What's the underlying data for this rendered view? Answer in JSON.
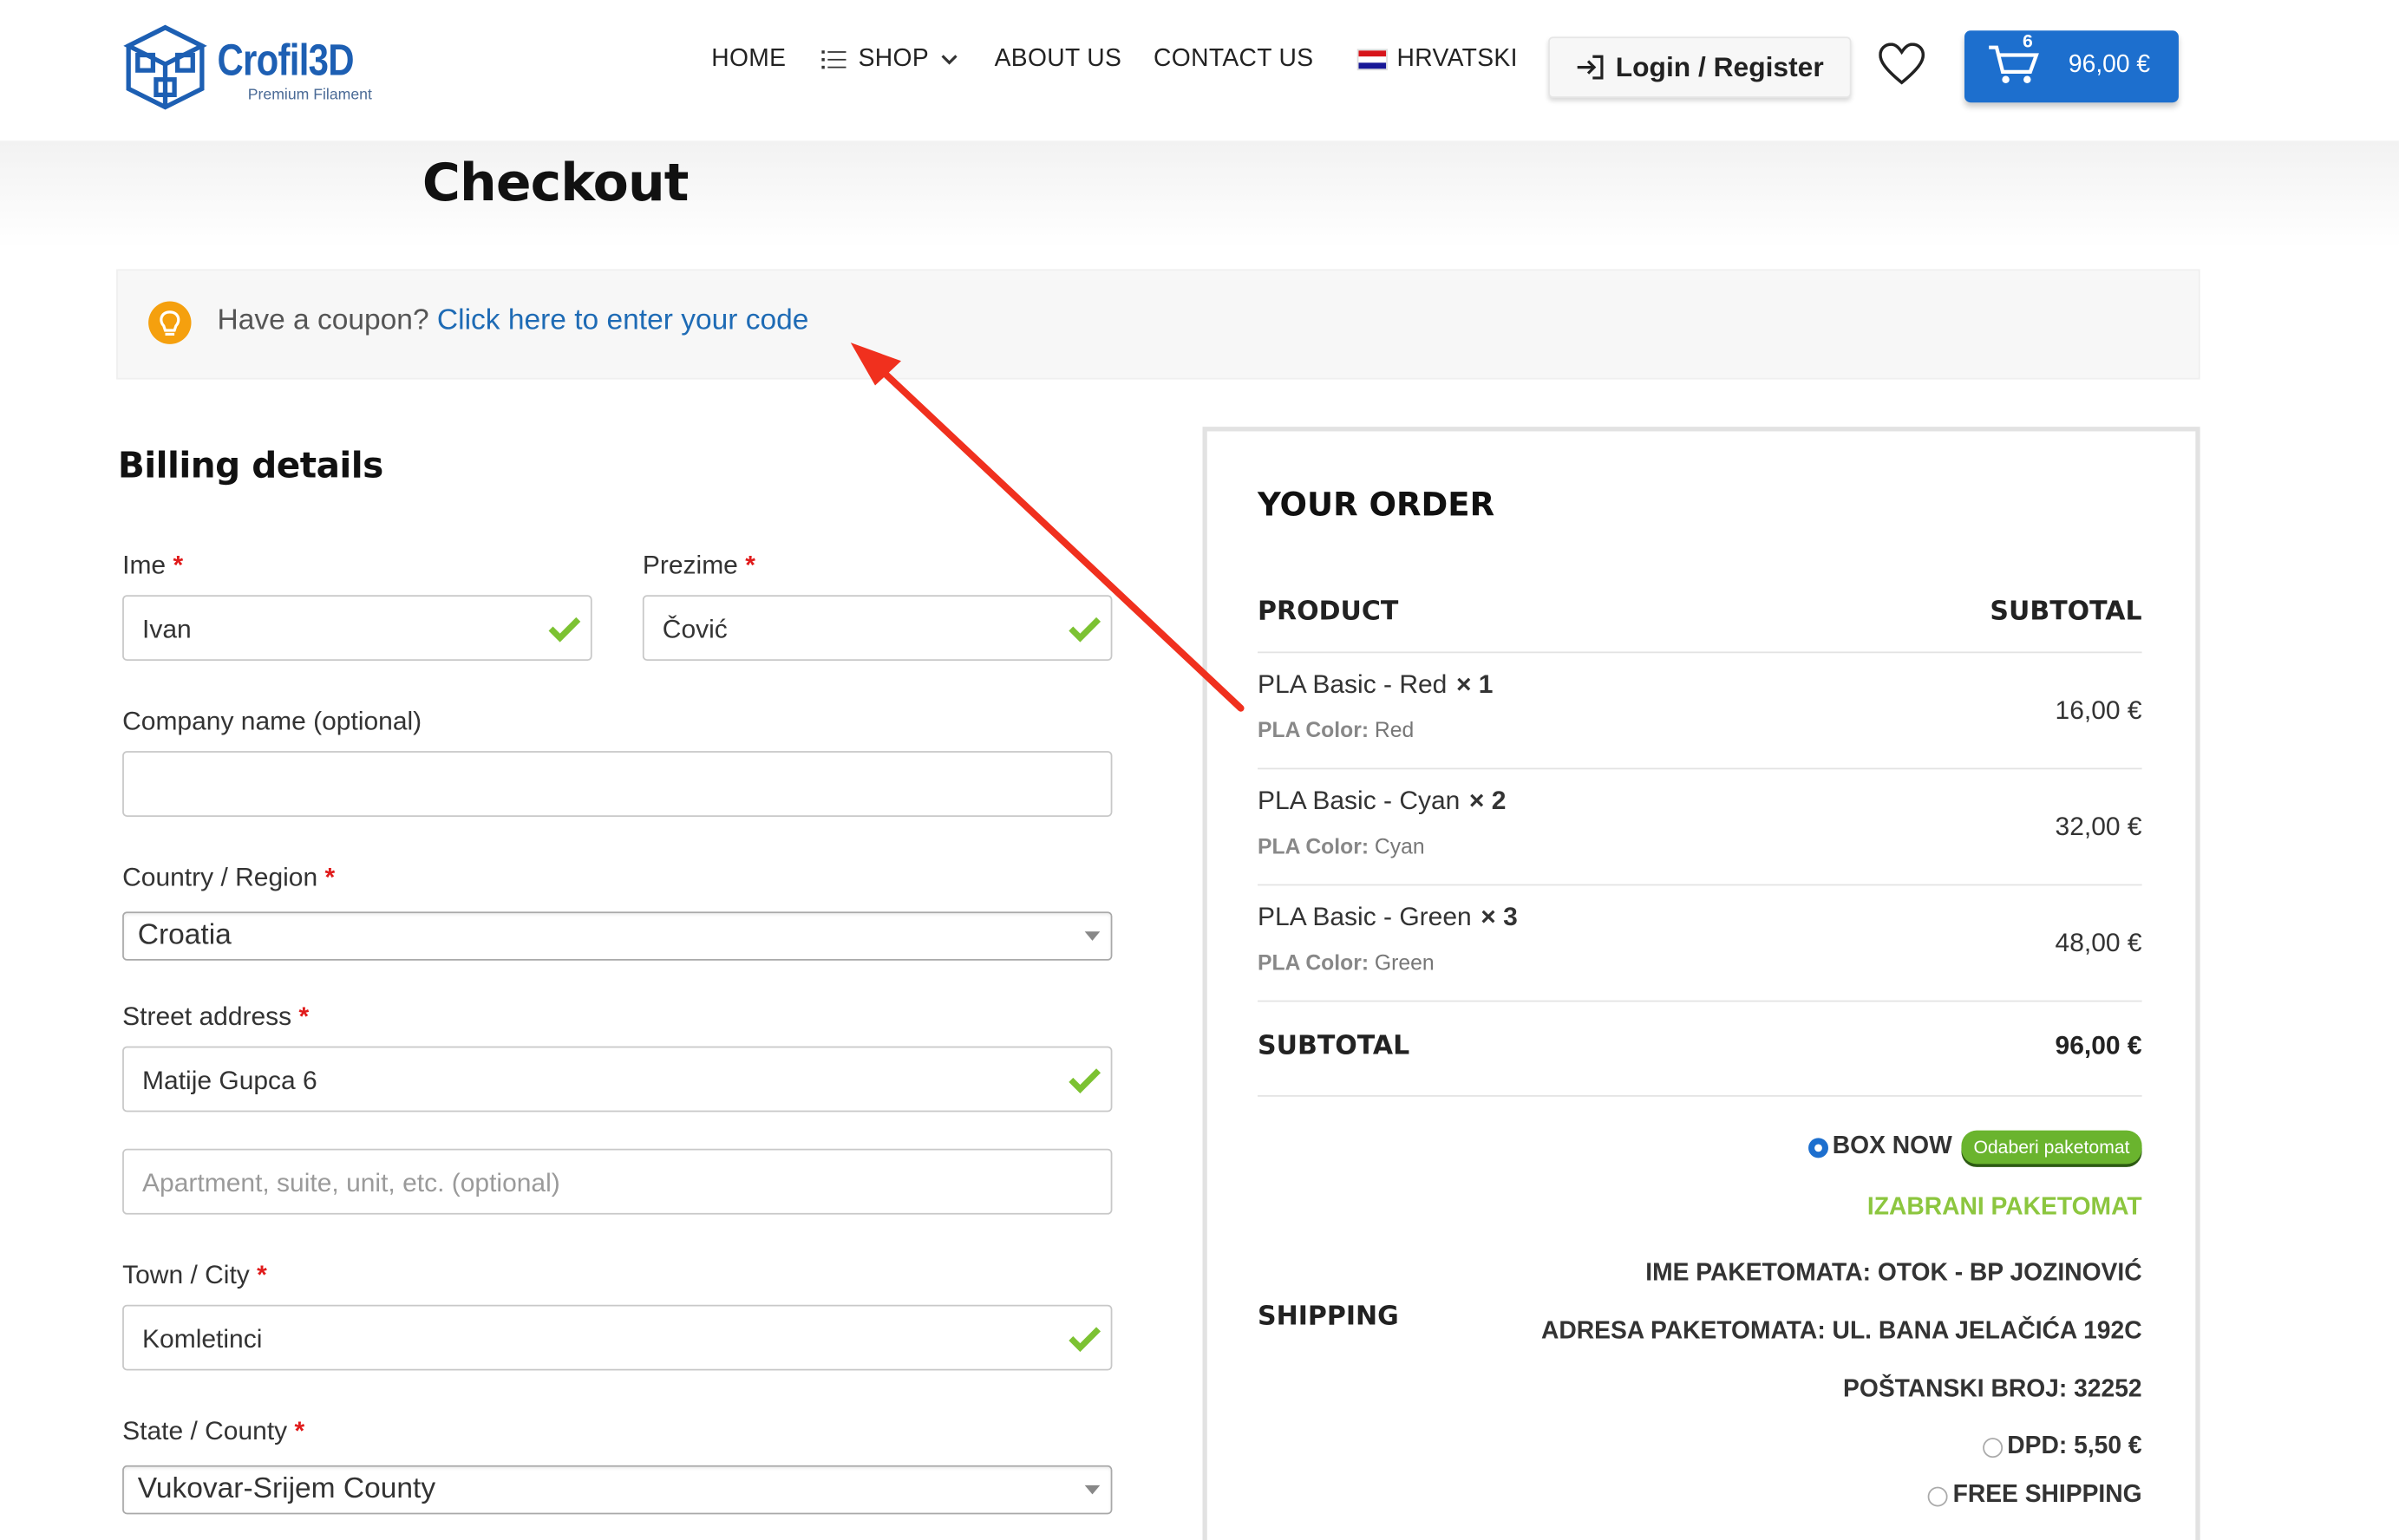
{
  "header": {
    "logo_name": "Crofil3D",
    "logo_tagline": "Premium Filament",
    "nav": {
      "home": "HOME",
      "shop": "SHOP",
      "about": "ABOUT US",
      "contact": "CONTACT US",
      "language": "HRVATSKI"
    },
    "login_label": "Login / Register",
    "cart_count": "6",
    "cart_total": "96,00 €"
  },
  "page": {
    "title": "Checkout"
  },
  "coupon": {
    "text": "Have a coupon?",
    "link": "Click here to enter your code"
  },
  "billing": {
    "title": "Billing details",
    "first_name": {
      "label": "Ime",
      "value": "Ivan"
    },
    "last_name": {
      "label": "Prezime",
      "value": "Čović"
    },
    "company": {
      "label": "Company name (optional)",
      "value": ""
    },
    "country": {
      "label": "Country / Region",
      "value": "Croatia"
    },
    "street": {
      "label": "Street address",
      "value": "Matije Gupca 6"
    },
    "apartment": {
      "placeholder": "Apartment, suite, unit, etc. (optional)"
    },
    "city": {
      "label": "Town / City",
      "value": "Komletinci"
    },
    "county": {
      "label": "State / County",
      "value": "Vukovar-Srijem County"
    },
    "required_mark": "*"
  },
  "order": {
    "title": "YOUR ORDER",
    "col_product": "PRODUCT",
    "col_subtotal": "SUBTOTAL",
    "items": [
      {
        "name": "PLA Basic - Red",
        "qty": "× 1",
        "meta_label": "PLA Color:",
        "meta_value": "Red",
        "price": "16,00 €"
      },
      {
        "name": "PLA Basic - Cyan",
        "qty": "× 2",
        "meta_label": "PLA Color:",
        "meta_value": "Cyan",
        "price": "32,00 €"
      },
      {
        "name": "PLA Basic - Green",
        "qty": "× 3",
        "meta_label": "PLA Color:",
        "meta_value": "Green",
        "price": "48,00 €"
      }
    ],
    "subtotal_label": "SUBTOTAL",
    "subtotal_value": "96,00 €",
    "shipping": {
      "label": "SHIPPING",
      "box_now": "BOX NOW",
      "box_now_button": "Odaberi paketomat",
      "selected_title": "IZABRANI PAKETOMAT",
      "locker_name": "IME PAKETOMATA: OTOK - BP JOZINOVIĆ",
      "locker_address": "ADRESA PAKETOMATA: UL. BANA JELAČIĆA 192C",
      "postal_code": "POŠTANSKI BROJ: 32252",
      "dpd": "DPD: 5,50 €",
      "free": "FREE SHIPPING"
    }
  },
  "colors": {
    "brand_blue": "#1d6fce",
    "link_blue": "#1e6bb5",
    "required_red": "#e01b1b",
    "accent_green": "#8cc63f",
    "annotation_arrow": "#f0301e"
  }
}
